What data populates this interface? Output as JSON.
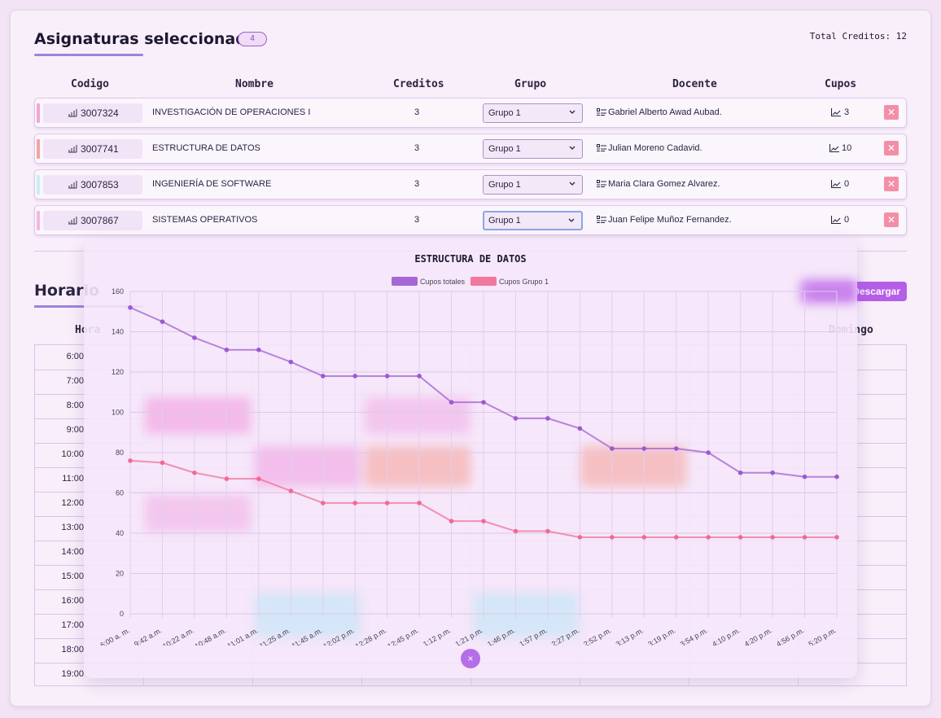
{
  "header": {
    "title": "Asignaturas seleccionadas",
    "count_badge": "4",
    "total_label": "Total Creditos: 12"
  },
  "columns": [
    "Codigo",
    "Nombre",
    "Creditos",
    "Grupo",
    "Docente",
    "Cupos"
  ],
  "rows": [
    {
      "code": "3007324",
      "name": "INVESTIGACIÓN DE OPERACIONES I",
      "credits": "3",
      "group": "Grupo 1",
      "teacher": "Gabriel Alberto Awad Aubad.",
      "cupos": "3",
      "color": "#f3a6d6"
    },
    {
      "code": "3007741",
      "name": "ESTRUCTURA DE DATOS",
      "credits": "3",
      "group": "Grupo 1",
      "teacher": "Julian Moreno Cadavid.",
      "cupos": "10",
      "color": "#f3a69c"
    },
    {
      "code": "3007853",
      "name": "INGENIERÍA DE SOFTWARE",
      "credits": "3",
      "group": "Grupo 1",
      "teacher": "Maria Clara Gomez Alvarez.",
      "cupos": "0",
      "color": "#c8ecf6"
    },
    {
      "code": "3007867",
      "name": "SISTEMAS OPERATIVOS",
      "credits": "3",
      "group": "Grupo 1",
      "teacher": "Juan Felipe Muñoz Fernandez.",
      "cupos": "0",
      "color": "#f3b8e4"
    }
  ],
  "schedule": {
    "title": "Horario",
    "download_label": "Descargar",
    "days_visible": {
      "first": "Hora",
      "last": "Domingo"
    },
    "hours": [
      "6:00",
      "7:00",
      "8:00",
      "9:00",
      "10:00",
      "11:00",
      "12:00",
      "13:00",
      "14:00",
      "15:00",
      "16:00",
      "17:00",
      "18:00",
      "19:00"
    ]
  },
  "modal": {
    "title": "ESTRUCTURA DE DATOS",
    "close_label": "×"
  },
  "chart_data": {
    "type": "line",
    "title": "ESTRUCTURA DE DATOS",
    "x": [
      "6:00 a. m.",
      "9:42 a.m.",
      "10:22 a.m.",
      "10:48 a.m.",
      "11:01 a.m.",
      "11:25 a.m.",
      "11:45 a.m.",
      "12:02 p.m.",
      "12:28 p.m.",
      "12:45 p.m.",
      "1:12 p.m.",
      "1:21 p.m.",
      "1:46 p.m.",
      "1:57 p.m.",
      "2:27 p.m.",
      "2:52 p.m.",
      "3:13 p.m.",
      "3:19 p.m.",
      "3:54 p.m.",
      "4:10 p.m.",
      "4:20 p.m.",
      "4:56 p.m.",
      "5:20 p.m."
    ],
    "series": [
      {
        "name": "Cupos totales",
        "color": "#9b59d0",
        "values": [
          152,
          145,
          137,
          131,
          131,
          125,
          118,
          118,
          118,
          118,
          105,
          105,
          97,
          97,
          92,
          82,
          82,
          82,
          80,
          70,
          70,
          68,
          68
        ]
      },
      {
        "name": "Cupos Grupo 1",
        "color": "#f06a94",
        "values": [
          76,
          75,
          70,
          67,
          67,
          61,
          55,
          55,
          55,
          55,
          46,
          46,
          41,
          41,
          38,
          38,
          38,
          38,
          38,
          38,
          38,
          38,
          38
        ]
      }
    ],
    "ylim": [
      0,
      160
    ],
    "yticks": [
      0,
      20,
      40,
      60,
      80,
      100,
      120,
      140,
      160
    ],
    "grid": true,
    "legend": "top"
  }
}
